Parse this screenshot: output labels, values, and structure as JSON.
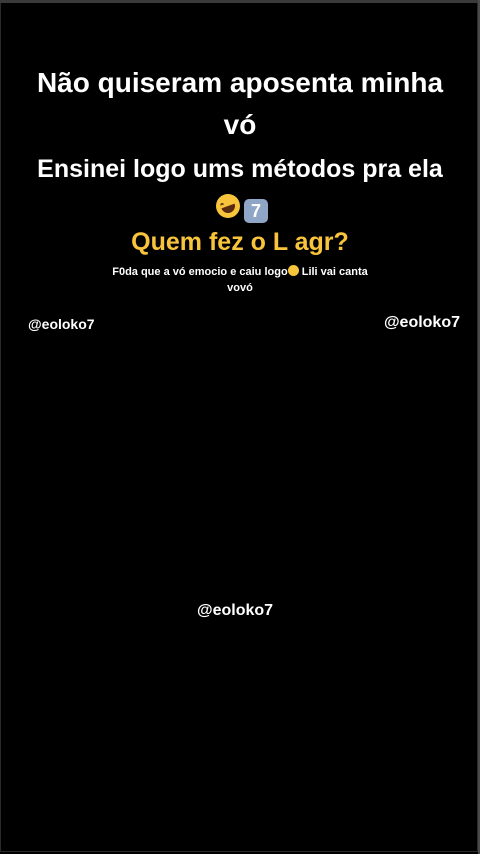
{
  "story": {
    "headline": "Não quiseram aposenta minha vó",
    "subline": "Ensinei logo ums métodos pra ela",
    "subline_emoji_1": "rolling-on-floor-laughing-emoji",
    "subline_keycap": "7",
    "yellow_caption": "Quem fez o L agr?",
    "small_caption_part1": "F0da que a vó emocio e caiu logo",
    "small_caption_emoji": "drooling-face-emoji",
    "small_caption_part2": " Lili vai canta vovó",
    "handle_left": "@eoloko7",
    "handle_right": "@eoloko7",
    "handle_center": "@eoloko7"
  },
  "colors": {
    "background": "#000000",
    "text": "#ffffff",
    "accent_yellow": "#f7c43b"
  }
}
